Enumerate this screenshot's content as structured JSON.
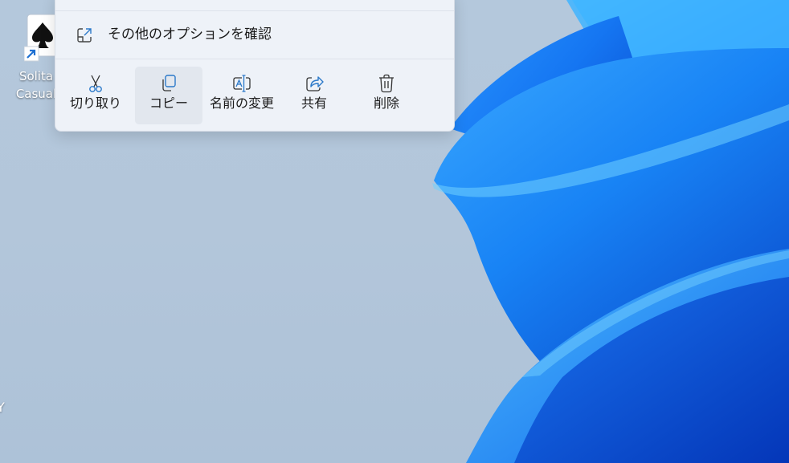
{
  "desktop": {
    "icons": [
      {
        "label": "Solita\nCasual",
        "icon": "solitaire-app-icon",
        "shortcut_overlay": "shortcut-arrow-icon"
      }
    ],
    "edge_glyph": "Y"
  },
  "context_menu": {
    "more_options": {
      "label": "その他のオプションを確認",
      "icon": "open-external-icon"
    },
    "actions": [
      {
        "label": "切り取り",
        "icon": "scissors-icon",
        "hovered": false
      },
      {
        "label": "コピー",
        "icon": "copy-icon",
        "hovered": true
      },
      {
        "label": "名前の変更",
        "icon": "rename-icon",
        "hovered": false
      },
      {
        "label": "共有",
        "icon": "share-icon",
        "hovered": false
      },
      {
        "label": "削除",
        "icon": "trash-icon",
        "hovered": false
      }
    ]
  },
  "colors": {
    "menu_background": "#eef2f8",
    "icon_blue": "#2b79c9",
    "text": "#1a1a1a",
    "hover": "#e2e7ee",
    "wallpaper_blue": "#1a7cf0"
  }
}
